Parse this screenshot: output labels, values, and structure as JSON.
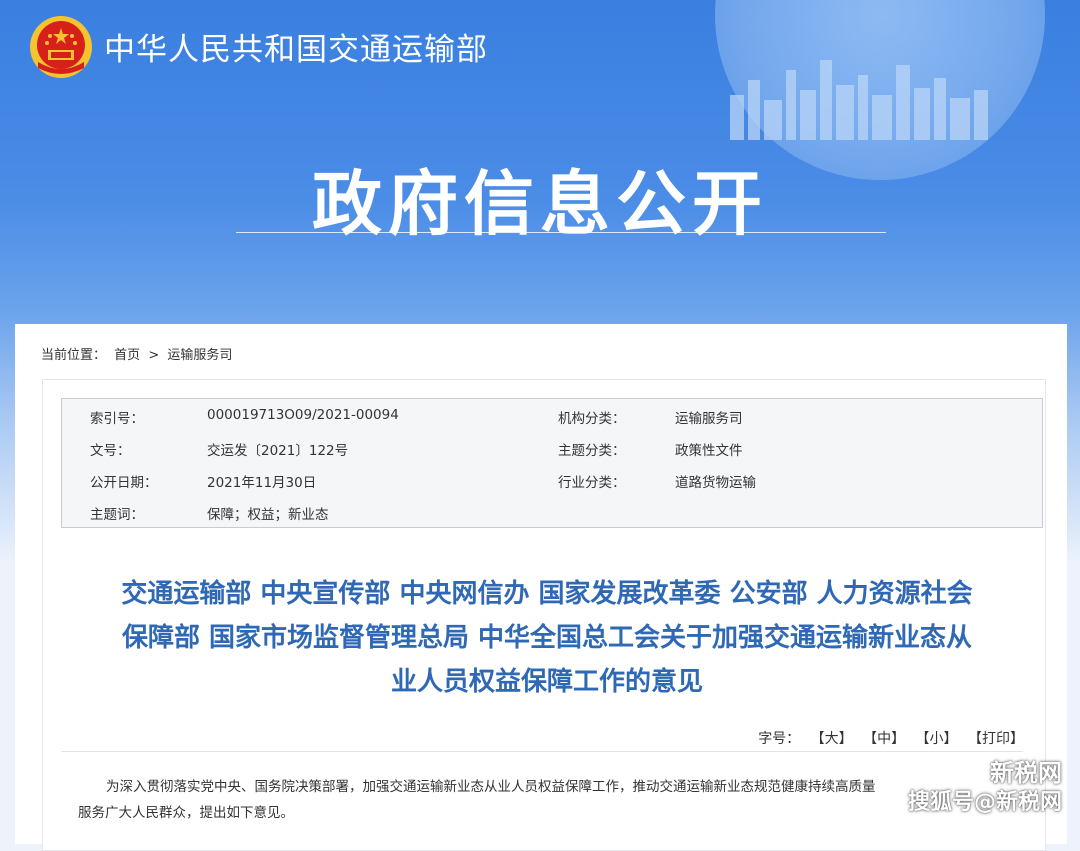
{
  "header": {
    "ministry_name": "中华人民共和国交通运输部",
    "hero_title": "政府信息公开"
  },
  "breadcrumb": {
    "prefix": "当前位置：",
    "home": "首页",
    "separator": ">",
    "current": "运输服务司"
  },
  "meta": {
    "index_label": "索引号：",
    "index_value": "000019713O09/2021-00094",
    "org_label": "机构分类：",
    "org_value": "运输服务司",
    "docno_label": "文号：",
    "docno_value": "交运发〔2021〕122号",
    "topic_label": "主题分类：",
    "topic_value": "政策性文件",
    "date_label": "公开日期：",
    "date_value": "2021年11月30日",
    "industry_label": "行业分类：",
    "industry_value": "道路货物运输",
    "keywords_label": "主题词：",
    "keywords_value": "保障；权益；新业态"
  },
  "document": {
    "title_line1": "交通运输部 中央宣传部 中央网信办 国家发展改革委 公安部 人力资源社会",
    "title_line2": "保障部 国家市场监督管理总局 中华全国总工会关于加强交通运输新业态从",
    "title_line3": "业人员权益保障工作的意见",
    "body_line1": "为深入贯彻落实党中央、国务院决策部署，加强交通运输新业态从业人员权益保障工作，推动交通运输新业态规范健康持续高质量",
    "body_line2": "服务广大人民群众，提出如下意见。"
  },
  "font_tools": {
    "label": "字号：",
    "large": "【大】",
    "medium": "【中】",
    "small": "【小】",
    "print": "【打印】"
  },
  "watermark": {
    "top": "新税网",
    "bottom": "搜狐号@新税网"
  },
  "colors": {
    "banner_blue": "#3a7fe0",
    "title_blue": "#2f68b4",
    "emblem_red": "#d8201b",
    "emblem_gold": "#f4c430"
  }
}
